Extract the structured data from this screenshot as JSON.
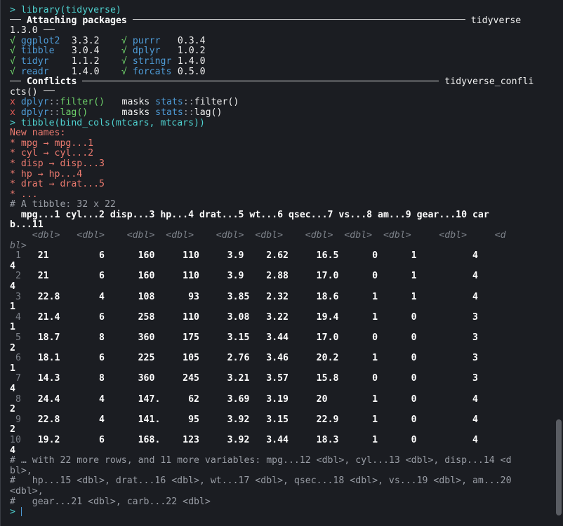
{
  "console": {
    "prompt": ">",
    "cmd1": "library(tidyverse)",
    "attach_header": "Attaching packages",
    "tidyverse_label": "tidyverse",
    "tidyverse_version": "1.3.0",
    "tick": "√",
    "packages": [
      {
        "name": "ggplot2",
        "version": "3.3.2"
      },
      {
        "name": "tibble",
        "version": "3.0.4"
      },
      {
        "name": "tidyr",
        "version": "1.1.2"
      },
      {
        "name": "readr",
        "version": "1.4.0"
      },
      {
        "name": "purrr",
        "version": "0.3.4"
      },
      {
        "name": "dplyr",
        "version": "1.0.2"
      },
      {
        "name": "stringr",
        "version": "1.4.0"
      },
      {
        "name": "forcats",
        "version": "0.5.0"
      }
    ],
    "conflicts_header": "Conflicts",
    "conflicts_label_part1": "tidyverse_confli",
    "conflicts_label_part2": "cts()",
    "conflicts": [
      {
        "pkg": "dplyr",
        "fn": "filter()",
        "masks": "masks",
        "stats": "stats",
        "sfn": "filter()"
      },
      {
        "pkg": "dplyr",
        "fn": "lag()",
        "masks": "masks",
        "stats": "stats",
        "sfn": "lag()"
      }
    ],
    "cmd2": "tibble(bind_cols(mtcars, mtcars))",
    "new_names_header": "New names:",
    "renames": [
      "* mpg → mpg...1",
      "* cyl → cyl...2",
      "* disp → disp...3",
      "* hp → hp...4",
      "* drat → drat...5",
      "* ..."
    ],
    "tibble_info": "# A tibble: 32 x 22",
    "col_header_1": "  mpg...1 cyl...2 disp...3 hp...4 drat...5 wt...6 qsec...7 vs...8 am...9 gear...10 car",
    "col_header_2": "b...11",
    "type_row_1": "    <dbl>   <dbl>    <dbl>  <dbl>    <dbl>  <dbl>    <dbl>  <dbl>  <dbl>     <dbl>     <d",
    "type_row_2": "bl>",
    "rows": [
      {
        "n": " 1",
        "vals": "   21         6      160     110     3.9    2.62     16.5      0      1          4",
        "carb": "4"
      },
      {
        "n": " 2",
        "vals": "   21         6      160     110     3.9    2.88     17.0      0      1          4",
        "carb": "4"
      },
      {
        "n": " 3",
        "vals": "   22.8       4      108      93     3.85   2.32     18.6      1      1          4",
        "carb": "1"
      },
      {
        "n": " 4",
        "vals": "   21.4       6      258     110     3.08   3.22     19.4      1      0          3",
        "carb": "1"
      },
      {
        "n": " 5",
        "vals": "   18.7       8      360     175     3.15   3.44     17.0      0      0          3",
        "carb": "2"
      },
      {
        "n": " 6",
        "vals": "   18.1       6      225     105     2.76   3.46     20.2      1      0          3",
        "carb": "1"
      },
      {
        "n": " 7",
        "vals": "   14.3       8      360     245     3.21   3.57     15.8      0      0          3",
        "carb": "4"
      },
      {
        "n": " 8",
        "vals": "   24.4       4      147.     62     3.69   3.19     20        1      0          4",
        "carb": "2"
      },
      {
        "n": " 9",
        "vals": "   22.8       4      141.     95     3.92   3.15     22.9      1      0          4",
        "carb": "2"
      },
      {
        "n": "10",
        "vals": "   19.2       6      168.    123     3.92   3.44     18.3      1      0          4",
        "carb": "4"
      }
    ],
    "footer": [
      "# … with 22 more rows, and 11 more variables: mpg...12 <dbl>, cyl...13 <dbl>, disp...14 <d",
      "bl>,",
      "#   hp...15 <dbl>, drat...16 <dbl>, wt...17 <dbl>, qsec...18 <dbl>, vs...19 <dbl>, am...20",
      "<dbl>,",
      "#   gear...21 <dbl>, carb...22 <dbl>"
    ]
  },
  "colors": {
    "background": "#1b1d22",
    "prompt": "#4fd2d0",
    "package": "#4e9bd6",
    "tick": "#6fd36b",
    "conflict_x": "#e05a55",
    "warning": "#ec7a6f",
    "comment": "#9a9ea6"
  }
}
